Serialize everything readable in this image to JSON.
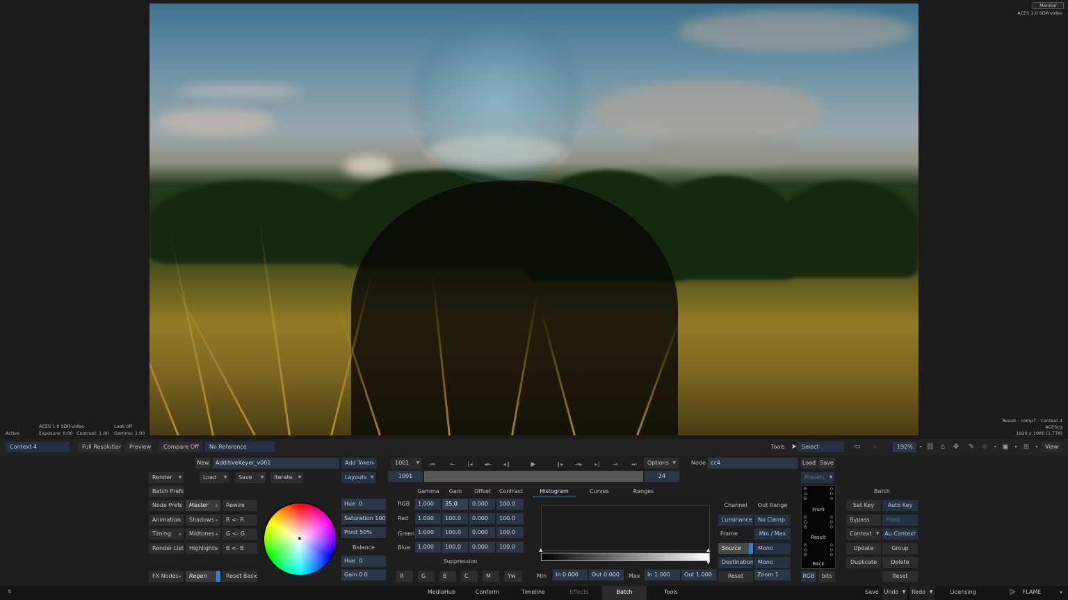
{
  "viewer": {
    "monitor_label": "Monitor",
    "colorspace_top_right": "ACES 1.0 SDR-video",
    "bottom_left": {
      "status": "Active",
      "view_transform": "ACES 1.0 SDR-video",
      "look": "Look off",
      "exposure": "Exposure: 0.00",
      "contrast": "Contrast: 1.00",
      "gamma": "Gamma: 1.00"
    },
    "bottom_right": {
      "result": "Result : comp7 : Context 4",
      "working_space": "ACEScg",
      "resolution": "1920 x 1080 (1.778)"
    }
  },
  "toolbar": {
    "context": "Context 4",
    "full_resolution": "Full Resolution",
    "preview": "Preview",
    "compare": "Compare Off",
    "reference": "No Reference",
    "tools_label": "Tools",
    "select_label": "Select",
    "zoom": "192%",
    "view_label": "View"
  },
  "batch": {
    "new_label": "New",
    "setup_name": "AdditiveKeyer_v001",
    "add_token": "Add Token",
    "render": "Render",
    "load": "Load",
    "save": "Save",
    "iterate": "Iterate",
    "layouts": "Layouts",
    "batch_prefs": "Batch Prefs",
    "node_prefs": "Node Prefs",
    "animation": "Animation",
    "timing": "Timing",
    "render_list": "Render List",
    "fx_nodes": "FX Nodes"
  },
  "transport": {
    "frame": "1001",
    "start_frame": "1001",
    "fps": "24",
    "options": "Options"
  },
  "node": {
    "label": "Node",
    "name": "cc4",
    "load": "Load",
    "save": "Save",
    "presets": "Presets"
  },
  "tone": {
    "master": "Master",
    "shadows": "Shadows",
    "midtones": "Midtones",
    "highlights": "Highlights",
    "regen": "Regen",
    "rewire": "Rewire",
    "r_from_r": "R <- R",
    "g_from_g": "G <- G",
    "b_from_b": "B <- B",
    "reset_basics": "Reset Basics"
  },
  "wheel_controls": {
    "hue": "Hue",
    "hue_value": "0",
    "saturation": "Saturation 100",
    "pivot": "Pivot 50%",
    "balance": "Balance",
    "balance_hue": "Hue",
    "balance_hue_value": "0",
    "gain": "Gain 0.0"
  },
  "grade": {
    "headers": [
      "Gamma",
      "Gain",
      "Offset",
      "Contrast"
    ],
    "rows": [
      {
        "label": "RGB",
        "values": [
          "1.000",
          "35.0",
          "0.000",
          "100.0"
        ]
      },
      {
        "label": "Red",
        "values": [
          "1.000",
          "100.0",
          "0.000",
          "100.0"
        ]
      },
      {
        "label": "Green",
        "values": [
          "1.000",
          "100.0",
          "0.000",
          "100.0"
        ]
      },
      {
        "label": "Blue",
        "values": [
          "1.000",
          "100.0",
          "0.000",
          "100.0"
        ]
      }
    ],
    "suppression": "Suppression",
    "suppression_channels": [
      "R",
      "G",
      "B",
      "C",
      "M",
      "Yw"
    ]
  },
  "histogram": {
    "tabs": [
      "Histogram",
      "Curves",
      "Ranges"
    ],
    "min_label": "Min",
    "min_in": "In 0.000",
    "min_out": "Out 0.000",
    "max_label": "Max",
    "max_in": "In 1.000",
    "max_out": "Out 1.000",
    "channel": "Channel",
    "out_range": "Out Range",
    "luminance": "Luminance",
    "no_clamp": "No Clamp",
    "frame": "Frame",
    "min_max": "Min / Max",
    "source": "Source",
    "mono1": "Mono",
    "destination": "Destination",
    "mono2": "Mono",
    "reset": "Reset",
    "zoom": "Zoom 1"
  },
  "readout": {
    "channels": [
      "R",
      "G",
      "B"
    ],
    "front_values": [
      "0",
      "0",
      "0"
    ],
    "front_label": "Front",
    "result_values": [
      "0",
      "0",
      "0"
    ],
    "result_label": "Result",
    "back_values": [
      "0",
      "0",
      "0"
    ],
    "back_label": "Back",
    "rgb_button": "RGB",
    "bits_button": "bits"
  },
  "batch_right": {
    "title": "Batch",
    "set_key": "Set Key",
    "auto_key": "Auto Key",
    "bypass": "Bypass",
    "front": "Front",
    "context": "Context",
    "au_context": "Au Context",
    "update": "Update",
    "group": "Group",
    "duplicate": "Duplicate",
    "delete": "Delete",
    "reset": "Reset"
  },
  "statusbar": {
    "tabs": [
      "MediaHub",
      "Conform",
      "Timeline",
      "Effects",
      "Batch",
      "Tools"
    ],
    "active_tab": "Batch",
    "save": "Save",
    "undo": "Undo",
    "redo": "Redo",
    "licensing": "Licensing",
    "app_name": "FLAME"
  },
  "colors": {
    "panel_bg": "#1e1e1e",
    "field_blue": "#2b3646",
    "accent_blue": "#2f7fd4"
  }
}
